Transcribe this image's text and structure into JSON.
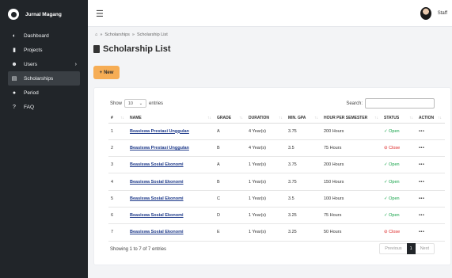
{
  "sidebar": {
    "brand": "Jurnal Magang",
    "items": [
      {
        "label": "Dashboard",
        "icon": "dashboard-icon"
      },
      {
        "label": "Projects",
        "icon": "projects-icon"
      },
      {
        "label": "Users",
        "icon": "users-icon"
      },
      {
        "label": "Scholarships",
        "icon": "scholarships-icon"
      },
      {
        "label": "Period",
        "icon": "period-icon"
      },
      {
        "label": "FAQ",
        "icon": "faq-icon"
      }
    ]
  },
  "topbar": {
    "user_name": "Staff"
  },
  "breadcrumb": {
    "sep": "»",
    "items": [
      "Scholarships",
      "Scholarship List"
    ]
  },
  "page": {
    "title": "Scholarship List",
    "new_label": "New"
  },
  "table": {
    "show_label": "Show",
    "show_value": "10",
    "entries_label": "entries",
    "search_label": "Search:",
    "headers": [
      "#",
      "NAME",
      "GRADE",
      "DURATION",
      "MIN. GPA",
      "HOUR PER SEMESTER",
      "STATUS",
      "ACTION"
    ],
    "rows": [
      {
        "no": "1",
        "name": "Beasiswa Prestasi Unggulan",
        "grade": "A",
        "duration": "4 Year(s)",
        "gpa": "3.75",
        "hours": "200 Hours",
        "status": "Open",
        "action": "•••"
      },
      {
        "no": "2",
        "name": "Beasiswa Prestasi Unggulan",
        "grade": "B",
        "duration": "4 Year(s)",
        "gpa": "3.5",
        "hours": "75 Hours",
        "status": "Close",
        "action": "•••"
      },
      {
        "no": "3",
        "name": "Beasiswa Sosial Ekonomi",
        "grade": "A",
        "duration": "1 Year(s)",
        "gpa": "3.75",
        "hours": "200 Hours",
        "status": "Open",
        "action": "•••"
      },
      {
        "no": "4",
        "name": "Beasiswa Sosial Ekonomi",
        "grade": "B",
        "duration": "1 Year(s)",
        "gpa": "3.75",
        "hours": "150 Hours",
        "status": "Open",
        "action": "•••"
      },
      {
        "no": "5",
        "name": "Beasiswa Sosial Ekonomi",
        "grade": "C",
        "duration": "1 Year(s)",
        "gpa": "3.5",
        "hours": "100 Hours",
        "status": "Open",
        "action": "•••"
      },
      {
        "no": "6",
        "name": "Beasiswa Sosial Ekonomi",
        "grade": "D",
        "duration": "1 Year(s)",
        "gpa": "3.25",
        "hours": "75 Hours",
        "status": "Open",
        "action": "•••"
      },
      {
        "no": "7",
        "name": "Beasiswa Sosial Ekonomi",
        "grade": "E",
        "duration": "1 Year(s)",
        "gpa": "3.25",
        "hours": "50 Hours",
        "status": "Close",
        "action": "•••"
      }
    ],
    "footer_info": "Showing 1 to 7 of 7 entries",
    "pager": {
      "prev": "Previous",
      "current": "1",
      "next": "Next"
    }
  },
  "colors": {
    "sidebar_bg": "#212529",
    "accent": "#f6ad55",
    "open": "#16a34a",
    "close": "#dc2626",
    "link": "#1e3a8a"
  }
}
